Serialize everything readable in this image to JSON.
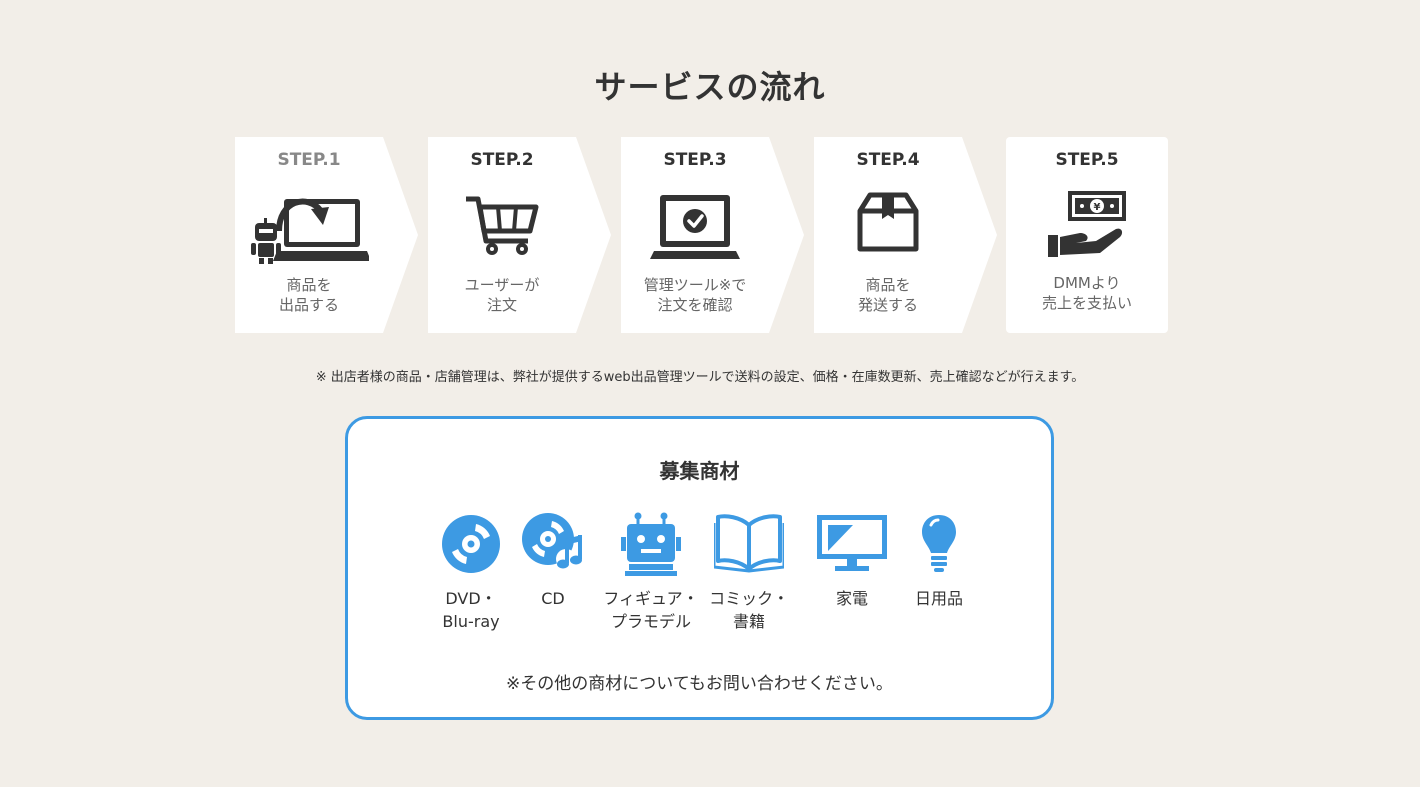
{
  "page": {
    "title": "サービスの流れ",
    "note": "※ 出店者様の商品・店舗管理は、弊社が提供するweb出品管理ツールで送料の設定、価格・在庫数更新、売上確認などが行えます。"
  },
  "steps": [
    {
      "label": "STEP.1",
      "text": "商品を\n出品する",
      "icon": "laptop-robot-icon"
    },
    {
      "label": "STEP.2",
      "text": "ユーザーが\n注文",
      "icon": "cart-icon"
    },
    {
      "label": "STEP.3",
      "text": "管理ツール※で\n注文を確認",
      "icon": "laptop-check-icon"
    },
    {
      "label": "STEP.4",
      "text": "商品を\n発送する",
      "icon": "box-icon"
    },
    {
      "label": "STEP.5",
      "text": "DMMより\n売上を支払い",
      "icon": "money-hand-icon"
    }
  ],
  "recruit": {
    "title": "募集商材",
    "categories": [
      {
        "label": "DVD・\nBlu-ray",
        "icon": "disc-icon"
      },
      {
        "label": "CD",
        "icon": "cd-music-icon"
      },
      {
        "label": "フィギュア・\nプラモデル",
        "icon": "robot-icon"
      },
      {
        "label": "コミック・\n書籍",
        "icon": "book-icon"
      },
      {
        "label": "家電",
        "icon": "monitor-icon"
      },
      {
        "label": "日用品",
        "icon": "lightbulb-icon"
      }
    ],
    "note": "※その他の商材についてもお問い合わせください。"
  },
  "colors": {
    "background": "#f2eee8",
    "accent": "#3d9ae3",
    "icon_dark": "#333333"
  }
}
